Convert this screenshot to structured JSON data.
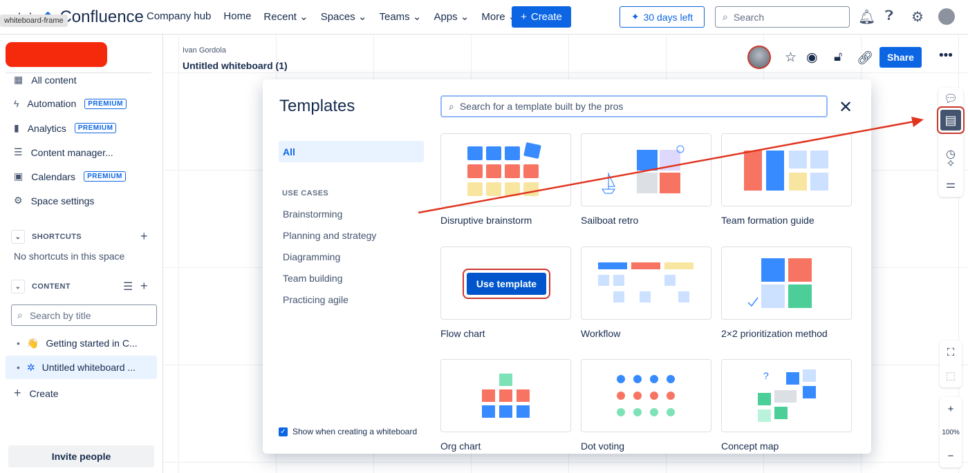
{
  "tooltip": "whiteboard-frame",
  "app": {
    "name": "Confluence"
  },
  "nav": {
    "items": [
      "Company hub",
      "Home",
      "Recent",
      "Spaces",
      "Teams",
      "Apps",
      "More"
    ],
    "create": "Create",
    "trial": "30 days left",
    "search_placeholder": "Search"
  },
  "sidebar": {
    "items": [
      {
        "label": "All content",
        "icon": "grid-icon"
      },
      {
        "label": "Automation",
        "icon": "lightning-icon",
        "badge": "PREMIUM"
      },
      {
        "label": "Analytics",
        "icon": "chart-icon",
        "badge": "PREMIUM"
      },
      {
        "label": "Content manager...",
        "icon": "list-check-icon"
      },
      {
        "label": "Calendars",
        "icon": "calendar-icon",
        "badge": "PREMIUM"
      },
      {
        "label": "Space settings",
        "icon": "gear-icon"
      }
    ],
    "shortcuts": {
      "title": "SHORTCUTS",
      "empty": "No shortcuts in this space"
    },
    "content": {
      "title": "CONTENT",
      "search_placeholder": "Search by title",
      "tree": [
        {
          "label": "Getting started in C...",
          "icon": "wave-emoji"
        },
        {
          "label": "Untitled whiteboard ...",
          "icon": "whiteboard-icon"
        }
      ],
      "create": "Create"
    },
    "invite": "Invite people"
  },
  "page": {
    "author": "Ivan Gordola",
    "title": "Untitled whiteboard (1)",
    "share": "Share"
  },
  "zoom": {
    "level": "100%"
  },
  "templates": {
    "title": "Templates",
    "search_placeholder": "Search for a template built by the pros",
    "all": "All",
    "use_cases_title": "USE CASES",
    "categories": [
      "Brainstorming",
      "Planning and strategy",
      "Diagramming",
      "Team building",
      "Practicing agile"
    ],
    "show_when_creating": "Show when creating a whiteboard",
    "use_template": "Use template",
    "cards": [
      "Disruptive brainstorm",
      "Sailboat retro",
      "Team formation guide",
      "Flow chart",
      "Workflow",
      "2×2 prioritization method",
      "Org chart",
      "Dot voting",
      "Concept map"
    ]
  },
  "colors": {
    "brand": "#0c66e4",
    "annotation": "#e0341f"
  }
}
